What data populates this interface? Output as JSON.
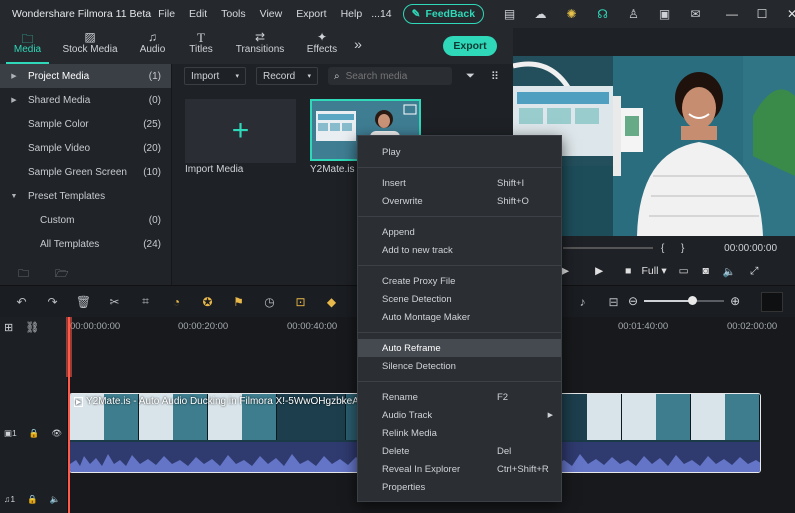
{
  "app": {
    "title": "Wondershare Filmora 11 Beta",
    "menu": [
      "File",
      "Edit",
      "Tools",
      "View",
      "Export",
      "Help",
      "...14"
    ],
    "feedback_label": "FeedBack",
    "accent": "#2fd8b8"
  },
  "tabs": [
    {
      "label": "Media",
      "icon": "media-folder-icon",
      "active": true
    },
    {
      "label": "Stock Media",
      "icon": "stock-media-icon",
      "active": false
    },
    {
      "label": "Audio",
      "icon": "music-note-icon",
      "active": false
    },
    {
      "label": "Titles",
      "icon": "text-t-icon",
      "active": false
    },
    {
      "label": "Transitions",
      "icon": "transitions-icon",
      "active": false
    },
    {
      "label": "Effects",
      "icon": "effects-sparkle-icon",
      "active": false
    }
  ],
  "export_label": "Export",
  "library": {
    "items": [
      {
        "name": "Project Media",
        "count": "(1)",
        "arrow": "right",
        "active": true
      },
      {
        "name": "Shared Media",
        "count": "(0)",
        "arrow": "right",
        "active": false
      },
      {
        "name": "Sample Color",
        "count": "(25)",
        "arrow": "",
        "active": false
      },
      {
        "name": "Sample Video",
        "count": "(20)",
        "arrow": "",
        "active": false
      },
      {
        "name": "Sample Green Screen",
        "count": "(10)",
        "arrow": "",
        "active": false
      },
      {
        "name": "Preset Templates",
        "count": "",
        "arrow": "down",
        "active": false
      },
      {
        "name": "Custom",
        "count": "(0)",
        "arrow": "",
        "sub": true
      },
      {
        "name": "All Templates",
        "count": "(24)",
        "arrow": "",
        "sub": true
      }
    ]
  },
  "media": {
    "import_dropdown": "Import",
    "record_dropdown": "Record",
    "search_placeholder": "Search media",
    "import_tile_label": "Import Media",
    "clip_label": "Y2Mate.is -"
  },
  "preview": {
    "brackets": "{      }",
    "timecode": "00:00:00:00",
    "quality": "Full"
  },
  "timeline": {
    "ruler": [
      "00:00:00:00",
      "00:00:20:00",
      "00:00:40:00",
      "00:01:40:00",
      "00:02:00:00"
    ],
    "clip_title": "Y2Mate.is - Auto Audio Ducking in Filmora X!-5WwOHgzbkeA",
    "video_track_label": "1",
    "audio_track_label": "1",
    "zoom_level": 0.6
  },
  "context_menu": {
    "groups": [
      [
        {
          "label": "Play",
          "shortcut": ""
        }
      ],
      [
        {
          "label": "Insert",
          "shortcut": "Shift+I"
        },
        {
          "label": "Overwrite",
          "shortcut": "Shift+O"
        }
      ],
      [
        {
          "label": "Append",
          "shortcut": ""
        },
        {
          "label": "Add to new track",
          "shortcut": ""
        }
      ],
      [
        {
          "label": "Create Proxy File",
          "shortcut": ""
        },
        {
          "label": "Scene Detection",
          "shortcut": ""
        },
        {
          "label": "Auto Montage Maker",
          "shortcut": ""
        }
      ],
      [
        {
          "label": "Auto Reframe",
          "shortcut": "",
          "highlighted": true
        },
        {
          "label": "Silence Detection",
          "shortcut": ""
        }
      ],
      [
        {
          "label": "Rename",
          "shortcut": "F2"
        },
        {
          "label": "Audio Track",
          "shortcut": "",
          "submenu": true
        },
        {
          "label": "Relink Media",
          "shortcut": ""
        },
        {
          "label": "Delete",
          "shortcut": "Del"
        },
        {
          "label": "Reveal In Explorer",
          "shortcut": "Ctrl+Shift+R"
        },
        {
          "label": "Properties",
          "shortcut": ""
        }
      ]
    ]
  }
}
